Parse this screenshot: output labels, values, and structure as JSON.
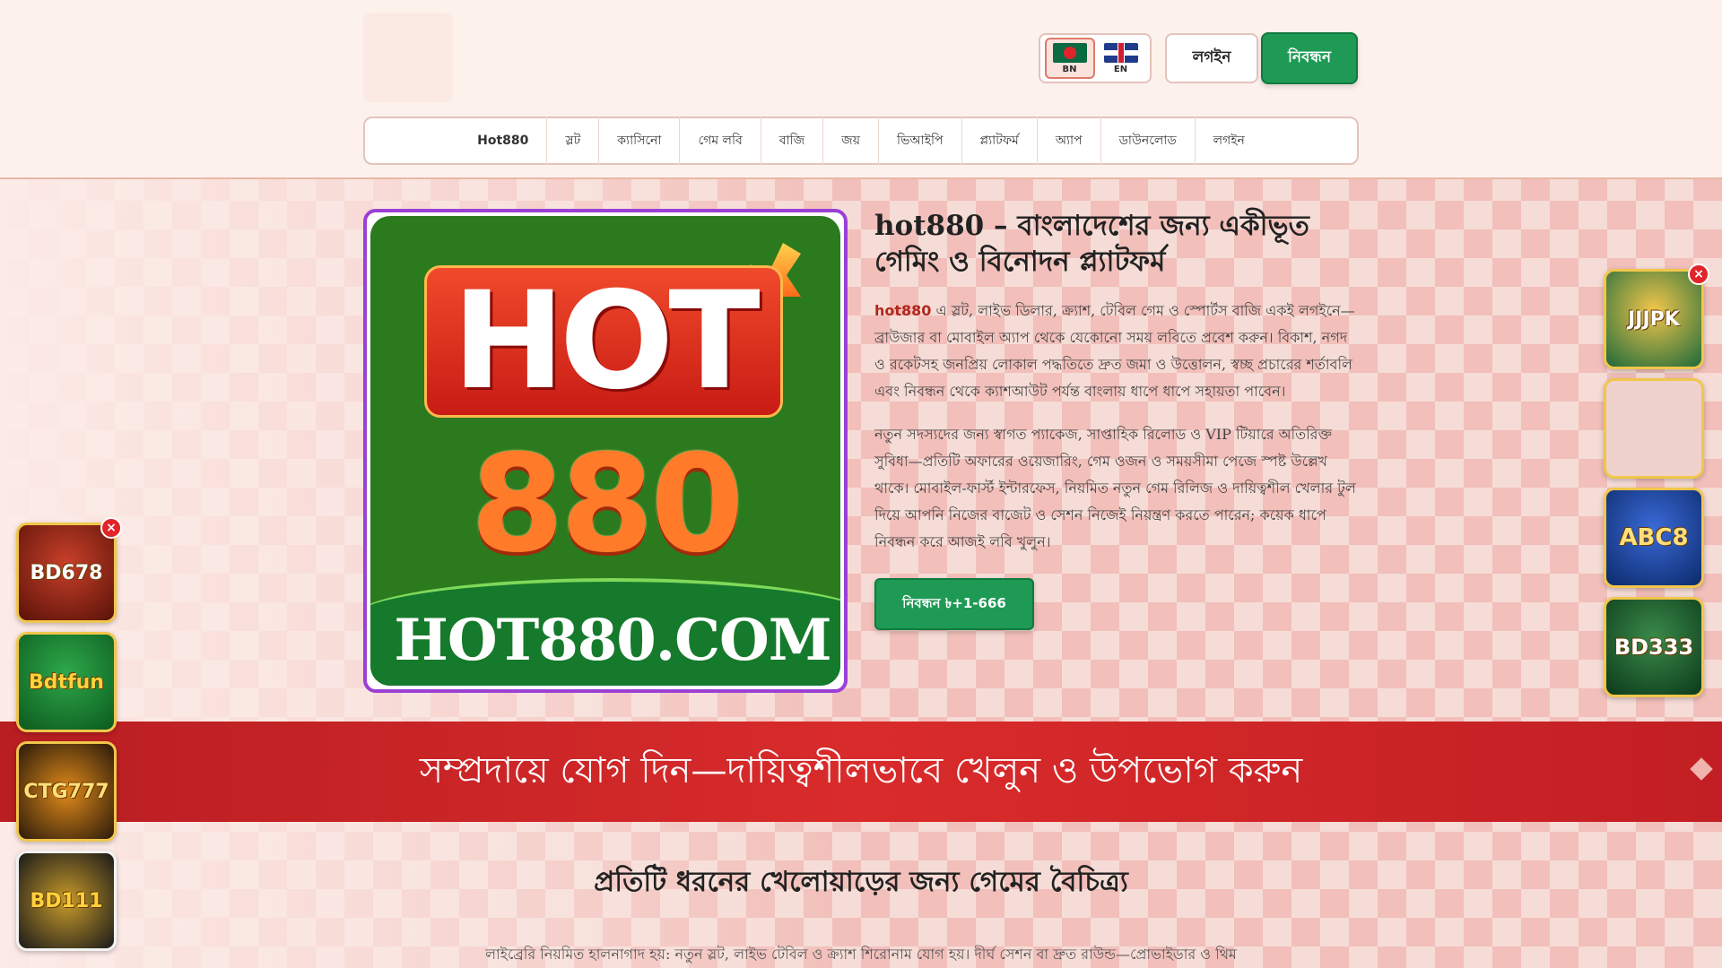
{
  "header": {
    "lang_options": [
      {
        "code": "BN",
        "active": true
      },
      {
        "code": "EN",
        "active": false
      }
    ],
    "login_label": "লগইন",
    "register_label": "নিবন্ধন"
  },
  "nav": {
    "items": [
      "Hot880",
      "স্লট",
      "ক্যাসিনো",
      "গেম লবি",
      "বাজি",
      "জয়",
      "ভিআইপি",
      "প্ল্যাটফর্ম",
      "অ্যাপ",
      "ডাউনলোড",
      "লগইন"
    ]
  },
  "hero": {
    "image_text": {
      "hot": "HOT",
      "number": "880",
      "domain": "HOT880.COM"
    },
    "title": "hot880 – বাংলাদেশের জন্য একীভূত গেমিং ও বিনোদন প্ল্যাটফর্ম",
    "p1_brand": "hot880",
    "p1_rest": " এ স্লট, লাইভ ডিলার, ক্র্যাশ, টেবিল গেম ও স্পোর্টস বাজি একই লগইনে—ব্রাউজার বা মোবাইল অ্যাপ থেকে যেকোনো সময় লবিতে প্রবেশ করুন। বিকাশ, নগদ ও রকেটসহ জনপ্রিয় লোকাল পদ্ধতিতে দ্রুত জমা ও উত্তোলন, স্বচ্ছ প্রচারের শর্তাবলি এবং নিবন্ধন থেকে ক্যাশআউট পর্যন্ত বাংলায় ধাপে ধাপে সহায়তা পাবেন।",
    "p2": "নতুন সদস্যদের জন্য স্বাগত প্যাকেজ, সাপ্তাহিক রিলোড ও VIP টিয়ারে অতিরিক্ত সুবিধা—প্রতিটি অফারের ওয়েজারিং, গেম ওজন ও সময়সীমা পেজে স্পষ্ট উল্লেখ থাকে। মোবাইল-ফার্স্ট ইন্টারফেস, নিয়মিত নতুন গেম রিলিজ ও দায়িত্বশীল খেলার টুল দিয়ে আপনি নিজের বাজেট ও সেশন নিজেই নিয়ন্ত্রণ করতে পারেন; কয়েক ধাপে নিবন্ধন করে আজই লবি খুলুন।",
    "cta_label": "নিবন্ধন ৳+1-666"
  },
  "banner": {
    "text": "সম্প্রদায়ে যোগ দিন—দায়িত্বশীলভাবে খেলুন ও উপভোগ করুন"
  },
  "section": {
    "title": "প্রতিটি ধরনের খেলোয়াড়ের জন্য গেমের বৈচিত্র্য",
    "text": "লাইব্রেরি নিয়মিত হালনাগাদ হয়: নতুন স্লট, লাইভ টেবিল ও ক্র্যাশ শিরোনাম যোগ হয়। দীর্ঘ সেশন বা দ্রুত রাউন্ড—প্রোভাইডার ও থিম"
  },
  "left_tiles": [
    "BD678",
    "Bdtfun",
    "CTG777",
    "BD111"
  ],
  "right_tiles": [
    "JJJPK",
    "",
    "ABC8",
    "BD333"
  ],
  "close_label": "×",
  "colors": {
    "accent_green": "#1f9a55",
    "banner_red": "#d92b2b",
    "brand_red": "#b0281c",
    "hero_border": "#9b3fd6"
  }
}
